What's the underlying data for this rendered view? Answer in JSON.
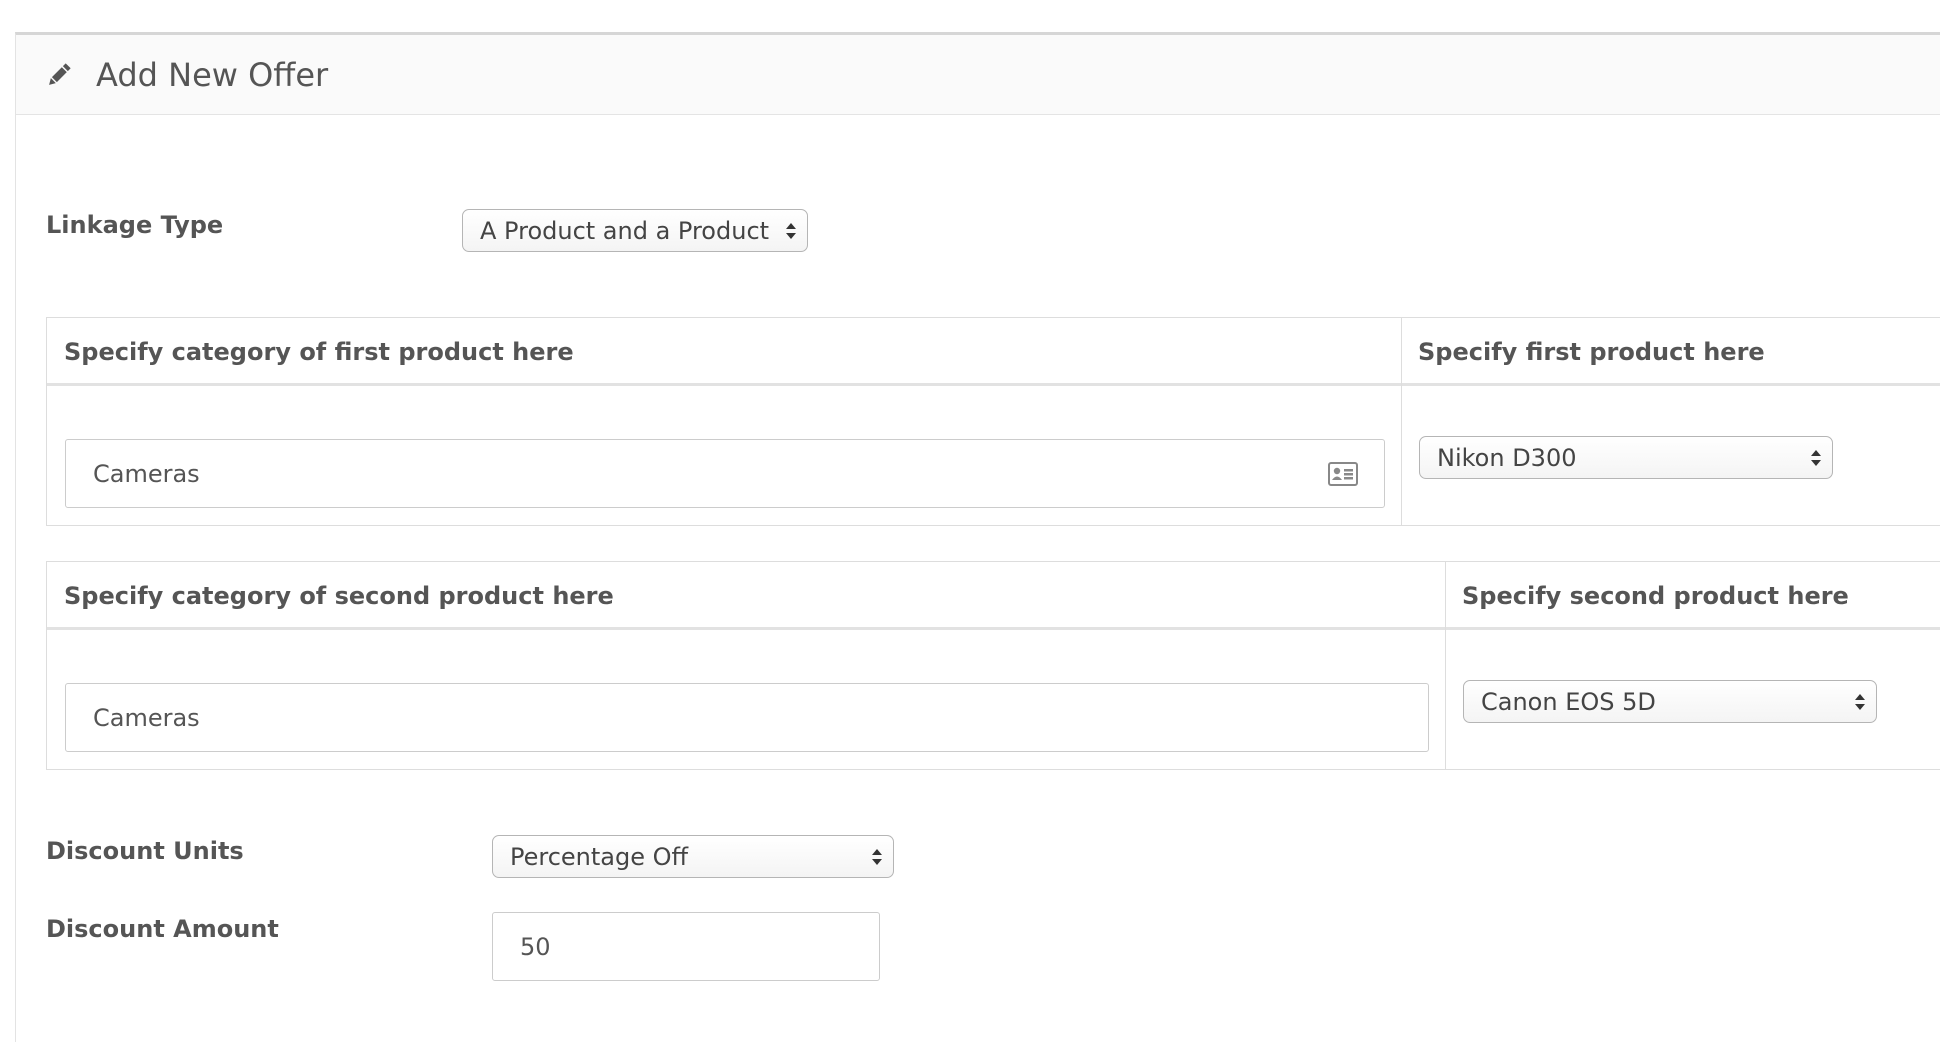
{
  "header": {
    "title": "Add New Offer",
    "icon": "pencil-icon"
  },
  "linkage": {
    "label": "Linkage Type",
    "value": "A Product and a Product"
  },
  "first": {
    "category_header": "Specify category of first product here",
    "product_header": "Specify first product here",
    "category_value": "Cameras",
    "product_value": "Nikon D300"
  },
  "second": {
    "category_header": "Specify category of second product here",
    "product_header": "Specify second product here",
    "category_value": "Cameras",
    "product_value": "Canon EOS 5D"
  },
  "discount": {
    "units_label": "Discount Units",
    "units_value": "Percentage Off",
    "amount_label": "Discount Amount",
    "amount_value": "50"
  },
  "colors": {
    "text": "#555555",
    "border": "#dddddd",
    "header_bg": "#fafafa"
  }
}
